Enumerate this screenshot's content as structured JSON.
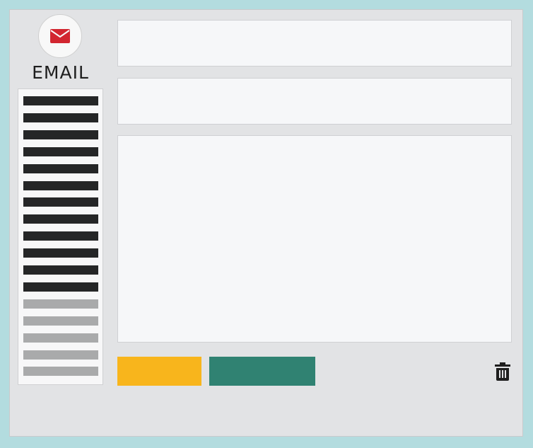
{
  "app": {
    "title": "EMAIL",
    "logo_icon": "envelope-icon"
  },
  "colors": {
    "background": "#b3dcdf",
    "window": "#e2e3e5",
    "field": "#f6f7f9",
    "accent_red": "#d22630",
    "button_yellow": "#f8b51c",
    "button_green": "#308272",
    "unread_item": "#252627",
    "read_item": "#a9aaab"
  },
  "mail_list": {
    "items": [
      {
        "status": "unread"
      },
      {
        "status": "unread"
      },
      {
        "status": "unread"
      },
      {
        "status": "unread"
      },
      {
        "status": "unread"
      },
      {
        "status": "unread"
      },
      {
        "status": "unread"
      },
      {
        "status": "unread"
      },
      {
        "status": "unread"
      },
      {
        "status": "unread"
      },
      {
        "status": "unread"
      },
      {
        "status": "unread"
      },
      {
        "status": "read"
      },
      {
        "status": "read"
      },
      {
        "status": "read"
      },
      {
        "status": "read"
      },
      {
        "status": "read"
      }
    ]
  },
  "compose": {
    "to_value": "",
    "subject_value": "",
    "body_value": ""
  },
  "toolbar": {
    "yellow_button_label": "",
    "green_button_label": "",
    "delete_icon": "trash-icon"
  }
}
